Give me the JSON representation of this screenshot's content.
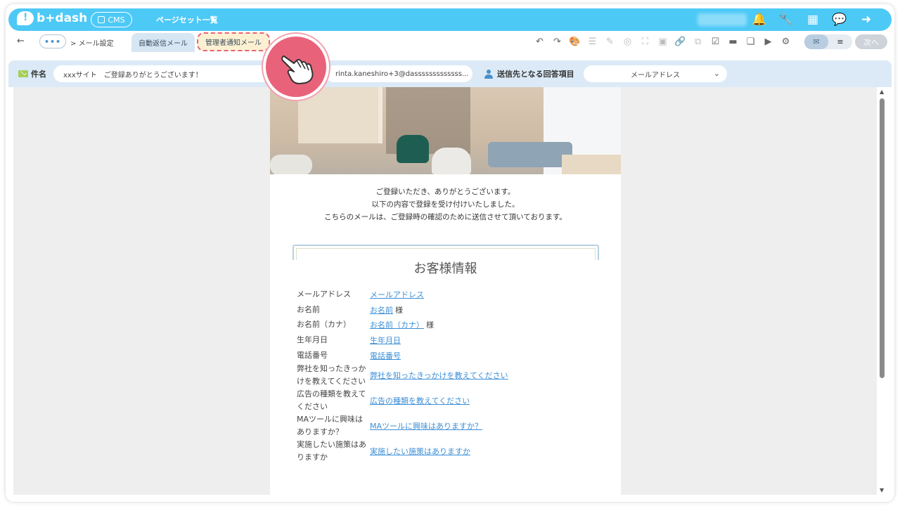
{
  "app": {
    "logo_text": "b+dash",
    "cms_label": "CMS",
    "page_set_label": "ページセット一覧"
  },
  "header_icons": [
    "bell-icon",
    "wrench-icon",
    "grid-icon",
    "chat-icon",
    "logout-icon"
  ],
  "breadcrumb": {
    "back": "←",
    "more": "•••",
    "separator": ">",
    "current": "メール設定"
  },
  "tabs": [
    {
      "label": "自動返信メール",
      "active": true
    },
    {
      "label": "管理者通知メール",
      "active": false,
      "highlighted": true
    }
  ],
  "toolbar": {
    "next_label": "次へ"
  },
  "subject": {
    "label": "件名",
    "value": "xxxサイト　ご登録ありがとうございます！"
  },
  "sender_email": "rinta.kaneshiro+3@dasssssssssssss...",
  "recipient": {
    "label": "送信先となる回答項目",
    "selected": "メールアドレス"
  },
  "email_body": {
    "intro_lines": [
      "ご登録いただき、ありがとうございます。",
      "以下の内容で登録を受け付けいたしました。",
      "こちらのメールは、ご登録時の確認のために送信させて頂いております。"
    ],
    "info_title": "お客様情報",
    "rows": [
      {
        "label": "メールアドレス",
        "value": "メールアドレス",
        "suffix": ""
      },
      {
        "label": "お名前",
        "value": "お名前",
        "suffix": "様"
      },
      {
        "label": "お名前（カナ）",
        "value": "お名前（カナ）",
        "suffix": "様"
      },
      {
        "label": "生年月日",
        "value": "生年月日",
        "suffix": ""
      },
      {
        "label": "電話番号",
        "value": "電話番号",
        "suffix": ""
      },
      {
        "label": "弊社を知ったきっかけを教えてください",
        "value": "弊社を知ったきっかけを教えてください",
        "suffix": ""
      },
      {
        "label": "広告の種類を教えてください",
        "value": "広告の種類を教えてください",
        "suffix": ""
      },
      {
        "label": "MAツールに興味はありますか？",
        "value": "MAツールに興味はありますか？",
        "suffix": ""
      },
      {
        "label": "実施したい施策はありますか",
        "value": "実施したい施策はありますか",
        "suffix": ""
      }
    ]
  },
  "colors": {
    "brand": "#4dc9f6",
    "highlight": "#e8637a",
    "link": "#3d8fd6"
  }
}
